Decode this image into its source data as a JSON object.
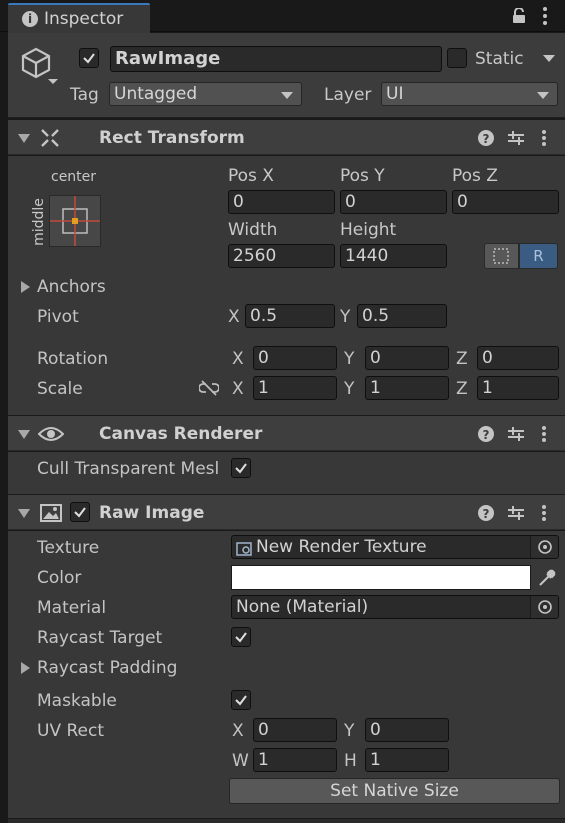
{
  "tab": {
    "title": "Inspector"
  },
  "object": {
    "name": "RawImage",
    "static_label": "Static",
    "tag_label": "Tag",
    "tag_value": "Untagged",
    "layer_label": "Layer",
    "layer_value": "UI"
  },
  "rect_transform": {
    "title": "Rect Transform",
    "anchor_h": "center",
    "anchor_v": "middle",
    "pos_x_label": "Pos X",
    "pos_x": "0",
    "pos_y_label": "Pos Y",
    "pos_y": "0",
    "pos_z_label": "Pos Z",
    "pos_z": "0",
    "width_label": "Width",
    "width": "2560",
    "height_label": "Height",
    "height": "1440",
    "raw_label": "R",
    "anchors_label": "Anchors",
    "pivot_label": "Pivot",
    "pivot_x_label": "X",
    "pivot_x": "0.5",
    "pivot_y_label": "Y",
    "pivot_y": "0.5",
    "rotation_label": "Rotation",
    "rot_x": "0",
    "rot_y": "0",
    "rot_z": "0",
    "scale_label": "Scale",
    "scale_x": "1",
    "scale_y": "1",
    "scale_z": "1",
    "x": "X",
    "y": "Y",
    "z": "Z"
  },
  "canvas_renderer": {
    "title": "Canvas Renderer",
    "cull_label": "Cull Transparent Mesl"
  },
  "raw_image": {
    "title": "Raw Image",
    "texture_label": "Texture",
    "texture_value": "New Render Texture",
    "color_label": "Color",
    "color_value": "#ffffff",
    "material_label": "Material",
    "material_value": "None (Material)",
    "raycast_target_label": "Raycast Target",
    "raycast_padding_label": "Raycast Padding",
    "maskable_label": "Maskable",
    "uvrect_label": "UV Rect",
    "uv_x_label": "X",
    "uv_x": "0",
    "uv_y_label": "Y",
    "uv_y": "0",
    "uv_w_label": "W",
    "uv_w": "1",
    "uv_h_label": "H",
    "uv_h": "1",
    "native_size_button": "Set Native Size"
  },
  "colors": {
    "accent_blue": "#3a5b82",
    "panel": "#383838",
    "header": "#3e3e3e"
  }
}
